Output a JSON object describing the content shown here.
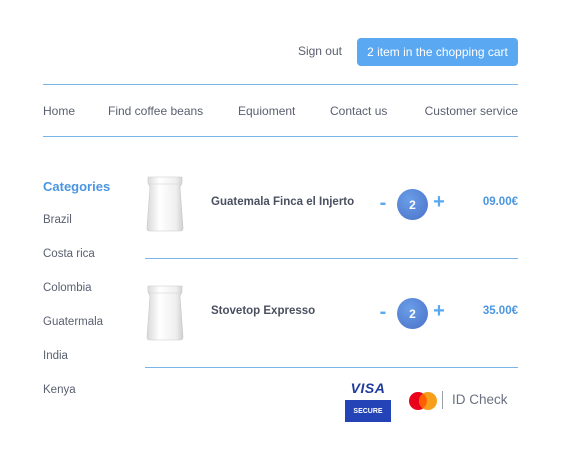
{
  "header": {
    "sign_out": "Sign out",
    "cart_button": "2 item in the chopping cart"
  },
  "nav": [
    {
      "label": "Home"
    },
    {
      "label": "Find coffee beans"
    },
    {
      "label": "Equioment"
    },
    {
      "label": "Contact us"
    },
    {
      "label": "Customer service"
    }
  ],
  "sidebar": {
    "title": "Categories",
    "items": [
      {
        "label": "Brazil"
      },
      {
        "label": "Costa rica"
      },
      {
        "label": "Colombia"
      },
      {
        "label": "Guatermala"
      },
      {
        "label": "India"
      },
      {
        "label": "Kenya"
      }
    ]
  },
  "cart": {
    "items": [
      {
        "name": "Guatemala Finca el Injerto",
        "quantity": "2",
        "price": "09.00€",
        "minus": "-",
        "plus": "+",
        "image": "coffee-bag-icon"
      },
      {
        "name": "Stovetop Expresso",
        "quantity": "2",
        "price": "35.00€",
        "minus": "-",
        "plus": "+",
        "image": "coffee-bag-icon"
      }
    ]
  },
  "payment": {
    "visa_label": "VISA",
    "visa_secure": "SECURE",
    "id_check": "ID Check"
  },
  "colors": {
    "accent": "#5aa8f2",
    "line": "#7ab5ea",
    "visa": "#2343b6"
  }
}
